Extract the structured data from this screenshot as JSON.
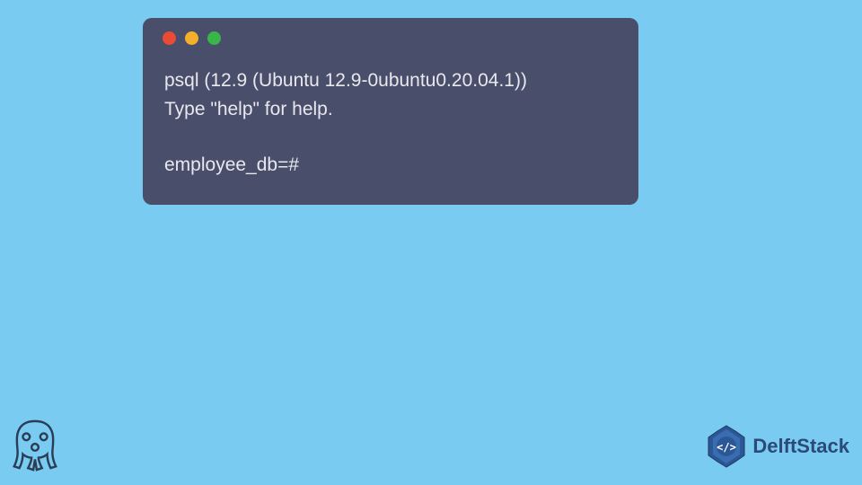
{
  "terminal": {
    "lines": {
      "line1": "psql (12.9 (Ubuntu 12.9-0ubuntu0.20.04.1))",
      "line2": "Type \"help\" for help.",
      "prompt": "employee_db=#"
    },
    "window_controls": {
      "close": "close",
      "minimize": "minimize",
      "maximize": "maximize"
    }
  },
  "branding": {
    "delft_text": "DelftStack"
  },
  "colors": {
    "background": "#79cbf2",
    "terminal_bg": "#494e6b",
    "terminal_text": "#e8e8ee",
    "dot_red": "#e94b35",
    "dot_yellow": "#f5b02a",
    "dot_green": "#39b54a",
    "delft_blue": "#2b4a78"
  }
}
